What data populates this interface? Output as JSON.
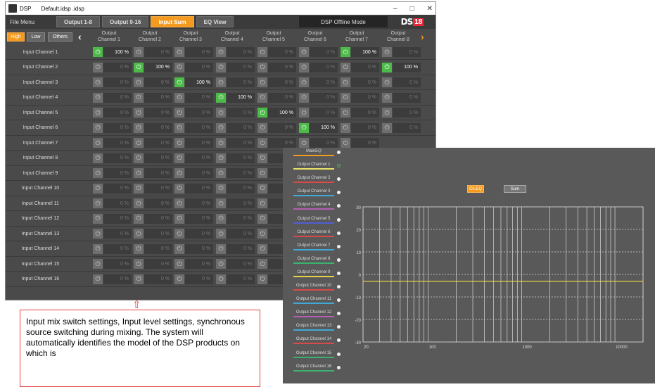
{
  "window": {
    "app_name": "DSP",
    "file_name": "Default.idsp .idsp",
    "controls": [
      "–",
      "□",
      "✕"
    ]
  },
  "menu": {
    "file_menu": "File Menu",
    "tabs": [
      {
        "label": "Output 1-8",
        "active": false
      },
      {
        "label": "Output 9-16",
        "active": false
      },
      {
        "label": "Input Sum",
        "active": true
      },
      {
        "label": "EQ View",
        "active": false
      }
    ],
    "offline_mode": "DSP Offline Mode",
    "logo": {
      "text": "DS",
      "badge": "18"
    }
  },
  "filters": [
    {
      "label": "High",
      "active": true
    },
    {
      "label": "Low",
      "active": false
    },
    {
      "label": "Others",
      "active": false
    }
  ],
  "arrows": {
    "left": "‹",
    "right": "›"
  },
  "output_columns": [
    {
      "line1": "Output",
      "line2": "Channel 1"
    },
    {
      "line1": "Output",
      "line2": "Channel 2"
    },
    {
      "line1": "Output",
      "line2": "Channel 3"
    },
    {
      "line1": "Output",
      "line2": "Channel 4"
    },
    {
      "line1": "Output",
      "line2": "Channel 5"
    },
    {
      "line1": "Output",
      "line2": "Channel 6"
    },
    {
      "line1": "Output",
      "line2": "Channel 7"
    },
    {
      "line1": "Output",
      "line2": "Channel 8"
    }
  ],
  "input_rows": [
    {
      "label": "Input Channel 1",
      "active_col": 0,
      "visible_cols": 8
    },
    {
      "label": "Input Channel 2",
      "active_col": 1,
      "visible_cols": 8,
      "also_on": [
        7
      ]
    },
    {
      "label": "Input Channel 3",
      "active_col": 2,
      "visible_cols": 8
    },
    {
      "label": "Input Channel 4",
      "active_col": 3,
      "visible_cols": 8
    },
    {
      "label": "Input Channel 5",
      "active_col": 4,
      "visible_cols": 8
    },
    {
      "label": "Input Channel 6",
      "active_col": 5,
      "visible_cols": 8
    },
    {
      "label": "Input Channel 7",
      "active_col": -1,
      "visible_cols": 7
    },
    {
      "label": "Input Channel 8",
      "active_col": -1,
      "visible_cols": 5
    },
    {
      "label": "Input Channel 9",
      "active_col": -1,
      "visible_cols": 5
    },
    {
      "label": "Input Channel 10",
      "active_col": -1,
      "visible_cols": 5
    },
    {
      "label": "Input Channel 11",
      "active_col": -1,
      "visible_cols": 5
    },
    {
      "label": "Input Channel 12",
      "active_col": -1,
      "visible_cols": 5
    },
    {
      "label": "Input Channel 13",
      "active_col": -1,
      "visible_cols": 5
    },
    {
      "label": "Input Channel 14",
      "active_col": -1,
      "visible_cols": 5
    },
    {
      "label": "Input Channel 15",
      "active_col": -1,
      "visible_cols": 5
    },
    {
      "label": "Input Channel 16",
      "active_col": -1,
      "visible_cols": 5
    }
  ],
  "row0_extra_on": 6,
  "level_on": "100  %",
  "level_off": "0  %",
  "power_icon": "⏻",
  "eq_panel": {
    "channels": [
      {
        "label": "MainEQ",
        "color": "#f39a1f",
        "dot": "filled"
      },
      {
        "label": "Output Channel 1",
        "color": "#e8e26b",
        "dot": "ring"
      },
      {
        "label": "Output Channel 2",
        "color": "#d94a4a",
        "dot": "filled"
      },
      {
        "label": "Output Channel 3",
        "color": "#3fa9d8",
        "dot": "filled"
      },
      {
        "label": "Output Channel 4",
        "color": "#b65fb5",
        "dot": "filled"
      },
      {
        "label": "Output Channel 5",
        "color": "#4f5fd4",
        "dot": "filled"
      },
      {
        "label": "Output Channel 6",
        "color": "#d94a4a",
        "dot": "filled"
      },
      {
        "label": "Output Channel 7",
        "color": "#3fa9d8",
        "dot": "filled"
      },
      {
        "label": "Output Channel 8",
        "color": "#3bb36e",
        "dot": "filled"
      },
      {
        "label": "Output Channel 9",
        "color": "#e8d24a",
        "dot": "filled"
      },
      {
        "label": "Output Channel 10",
        "color": "#d94a4a",
        "dot": "filled"
      },
      {
        "label": "Output Channel 11",
        "color": "#3fa9d8",
        "dot": "filled"
      },
      {
        "label": "Output Channel 12",
        "color": "#b65fb5",
        "dot": "filled"
      },
      {
        "label": "Output Channel 13",
        "color": "#3fa9d8",
        "dot": "filled"
      },
      {
        "label": "Output Channel 14",
        "color": "#d94a4a",
        "dot": "filled"
      },
      {
        "label": "Output Channel 15",
        "color": "#3bb36e",
        "dot": "filled"
      },
      {
        "label": "Output Channel 16",
        "color": "#3bb36e",
        "dot": "filled"
      }
    ],
    "buttons": [
      {
        "label": "Ch.EQ",
        "active": true
      },
      {
        "label": "Sum",
        "active": false
      }
    ]
  },
  "chart_data": {
    "type": "line",
    "title": "",
    "xlabel": "",
    "ylabel": "",
    "x_scale": "log",
    "xlim": [
      20,
      20000
    ],
    "ylim": [
      -30,
      30
    ],
    "x_ticks": [
      {
        "value": 20,
        "label": "20"
      },
      {
        "value": 100,
        "label": "100"
      },
      {
        "value": 1000,
        "label": "1000"
      },
      {
        "value": 10000,
        "label": "10000"
      }
    ],
    "y_ticks": [
      30,
      20,
      10,
      0,
      -10,
      -20,
      -30
    ],
    "grid": true,
    "series": [
      {
        "color": "#e8d24a",
        "x": [
          20,
          20000
        ],
        "y": [
          -3,
          -3
        ]
      }
    ]
  },
  "annotation": {
    "arrow": "⇧",
    "text": "Input mix switch settings, Input level settings, synchronous source switching during mixing. The system will automatically identifies the model of the DSP products on which is"
  }
}
